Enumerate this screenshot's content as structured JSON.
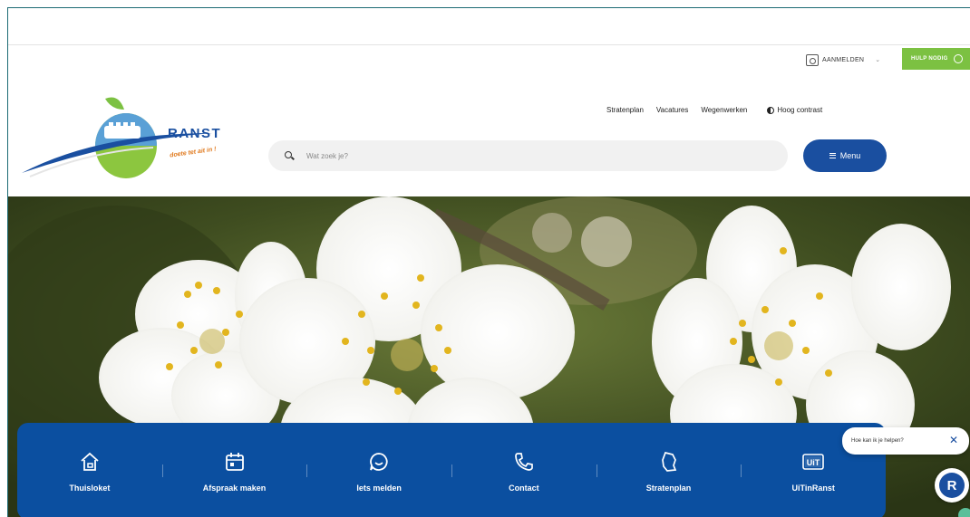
{
  "utility": {
    "login_label": "AANMELDEN",
    "help_label": "HULP NODIG"
  },
  "brand": {
    "name": "RANST",
    "slogan": "doete tet ait in !"
  },
  "topnav": [
    {
      "label": "Stratenplan"
    },
    {
      "label": "Vacatures"
    },
    {
      "label": "Wegenwerken"
    }
  ],
  "contrast_label": "Hoog contrast",
  "search": {
    "placeholder": "Wat zoek je?"
  },
  "menu_label": "Menu",
  "quicknav": [
    {
      "label": "Thuisloket",
      "icon": "home-icon"
    },
    {
      "label": "Afspraak maken",
      "icon": "calendar-icon"
    },
    {
      "label": "Iets melden",
      "icon": "chat-icon"
    },
    {
      "label": "Contact",
      "icon": "phone-icon"
    },
    {
      "label": "Stratenplan",
      "icon": "map-icon"
    },
    {
      "label": "UiTinRanst",
      "icon": "uit-icon"
    }
  ],
  "chat": {
    "prompt": "Hoe kan ik je helpen?",
    "close": "✕"
  },
  "badge": {
    "letter": "R"
  },
  "colors": {
    "brand_blue": "#1a4fa0",
    "help_green": "#7cc142",
    "quicknav_blue": "#0b4fa0"
  }
}
